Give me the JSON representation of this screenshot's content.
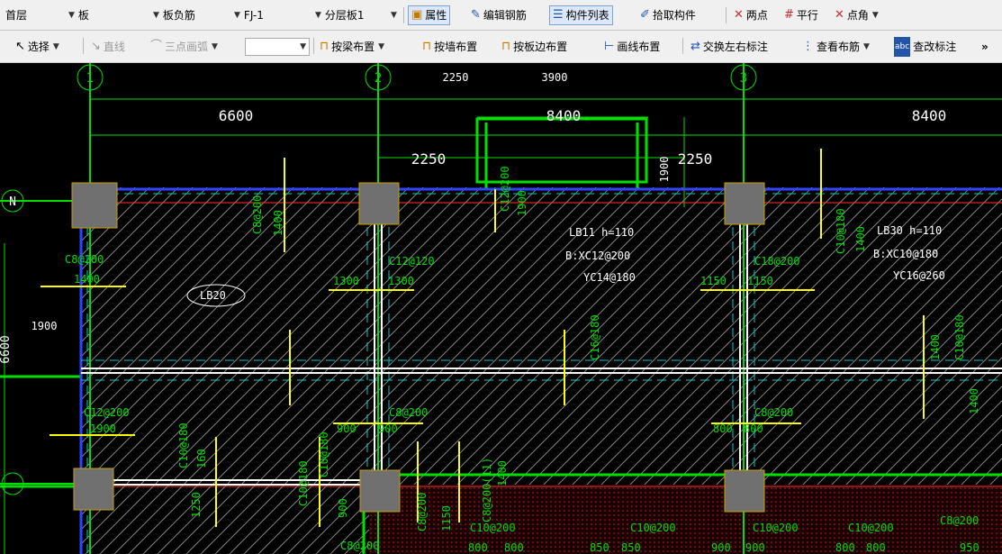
{
  "toolbar1": {
    "floor": "首层",
    "type": "板",
    "subtype": "板负筋",
    "component": "FJ-1",
    "layer": "分层板1",
    "btn_properties": "属性",
    "btn_edit_rebar": "编辑钢筋",
    "btn_component_list": "构件列表",
    "btn_pick": "拾取构件",
    "btn_two_points": "两点",
    "btn_parallel": "平行",
    "btn_point_angle": "点角"
  },
  "toolbar2": {
    "btn_select": "选择",
    "btn_line": "直线",
    "btn_arc": "三点画弧",
    "combo_value": "",
    "btn_by_beam": "按梁布置",
    "btn_by_wall": "按墙布置",
    "btn_by_slab_edge": "按板边布置",
    "btn_draw_line": "画线布置",
    "btn_swap": "交换左右标注",
    "btn_view_rebar": "查看布筋",
    "btn_modify_label": "查改标注",
    "overflow": "»"
  },
  "drawing": {
    "axes": [
      "1",
      "2",
      "3",
      "N"
    ],
    "dims": [
      "6600",
      "8400",
      "8400",
      "2250",
      "3900",
      "2250",
      "2250",
      "1900",
      "1900",
      "6600"
    ],
    "slabs": [
      {
        "name": "LB20"
      },
      {
        "name": "LB11 h=110",
        "b": "B:XC12@200",
        "t": "YC14@180"
      },
      {
        "name": "LB30 h=110",
        "b": "B:XC10@180",
        "t": "YC16@260"
      }
    ],
    "rebar_labels": [
      "C8@200",
      "1400",
      "C8@200",
      "1400",
      "C12@200",
      "1900",
      "C12@120",
      "1300",
      "1300",
      "C10@180",
      "1400",
      "C18@200",
      "1150",
      "1150",
      "C10@180",
      "160",
      "C16@180",
      "1400",
      "C10@180",
      "1400",
      "C12@200",
      "1900",
      "C8@200",
      "900",
      "900",
      "C8@200",
      "800",
      "800",
      "C10@180",
      "1250",
      "C10@180",
      "900",
      "C8@200(11)",
      "1400",
      "C8@200",
      "1150",
      "C10@200",
      "800",
      "800",
      "C10@200",
      "850",
      "850",
      "C10@200",
      "900",
      "900",
      "C10@200",
      "800",
      "800",
      "C8@200",
      "950",
      "C8@200"
    ]
  },
  "colors": {
    "bg": "#000000",
    "wall_green": "#00e000",
    "rebar_yellow": "#ffff00",
    "dim_red": "#ff3030",
    "beam_white": "#ffffff",
    "column_gray": "#707070",
    "edge_blue": "#3344ff",
    "dash_cyan": "#00cccc"
  }
}
